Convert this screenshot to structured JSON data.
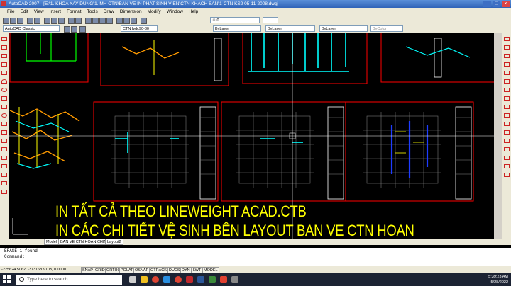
{
  "window": {
    "title": "AutoCAD 2007 - [E:\\1. KHOA XAY DUNG\\1. MH CTN\\BAN VE IN PHAT SINH VIEN\\CTN KHACH SAN\\1-CTN KS2 05-11-2008.dwg]"
  },
  "menu": [
    "File",
    "Edit",
    "View",
    "Insert",
    "Format",
    "Tools",
    "Draw",
    "Dimension",
    "Modify",
    "Window",
    "Help"
  ],
  "toolbar": {
    "workspace": "AutoCAD Classic",
    "dimstyle": "CTN Ivdc90-30",
    "color": "ByLayer",
    "linetype": "ByLayer",
    "lineweight": "ByLayer",
    "plotstyle": "ByColor"
  },
  "layout_tabs": [
    "Model",
    "BAN VE CTN HOAN CHINH",
    "Layout2"
  ],
  "command_lines": [
    "ERASE 1 found",
    "Command:"
  ],
  "status": {
    "coordinates": "-225624.5062, -373168.9103, 0.0000",
    "buttons": [
      "SNAP",
      "GRID",
      "ORTHO",
      "POLAR",
      "OSNAP",
      "OTRACK",
      "DUCS",
      "DYN",
      "LWT",
      "MODEL"
    ]
  },
  "overlay": {
    "line1": "IN TẤT CẢ THEO LINEWEIGHT ACAD.CTB",
    "line2": "IN CÁC CHI TIẾT VỆ SINH BÊN LAYOUT BAN VE CTN HOAN"
  },
  "taskbar": {
    "search_placeholder": "Type here to search",
    "time": "5:39:23 AM",
    "date": "5/28/2022"
  },
  "colors": {
    "overlay_text": "#ffff00",
    "frame": "#ff0000",
    "pipe_cyan": "#00ffff",
    "pipe_blue": "#1e3cff"
  }
}
